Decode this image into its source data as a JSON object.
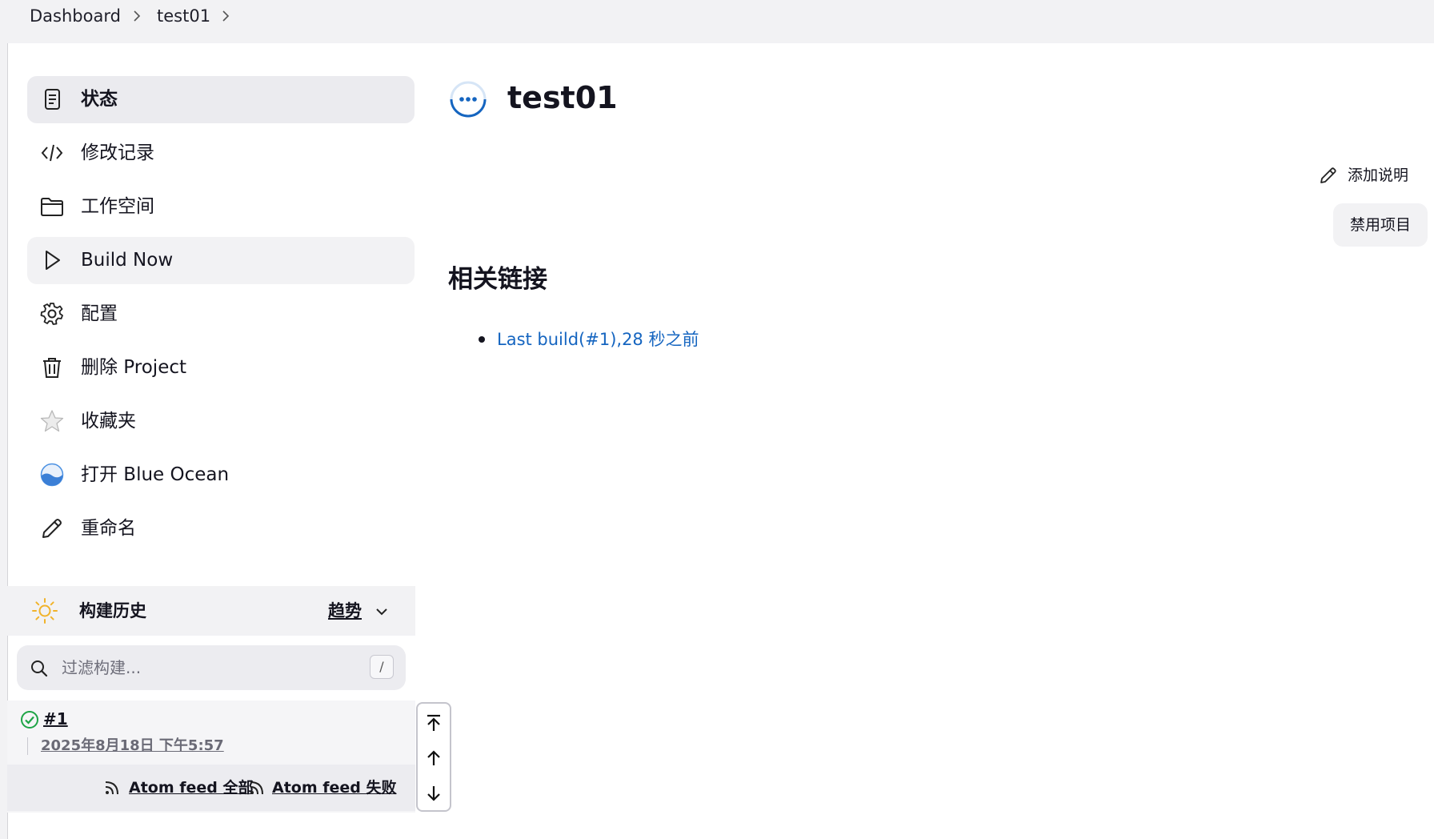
{
  "breadcrumb": [
    "Dashboard",
    "test01"
  ],
  "sidebar": {
    "items": [
      {
        "label": "状态",
        "icon": "document-icon",
        "state": "active"
      },
      {
        "label": "修改记录",
        "icon": "code-icon"
      },
      {
        "label": "工作空间",
        "icon": "folder-icon"
      },
      {
        "label": "Build Now",
        "icon": "play-icon",
        "state": "hover"
      },
      {
        "label": "配置",
        "icon": "gear-icon"
      },
      {
        "label": "删除 Project",
        "icon": "trash-icon"
      },
      {
        "label": "收藏夹",
        "icon": "star-icon"
      },
      {
        "label": "打开 Blue Ocean",
        "icon": "blue-ocean-icon"
      },
      {
        "label": "重命名",
        "icon": "pencil-icon"
      }
    ]
  },
  "build_history": {
    "title": "构建历史",
    "trend": "趋势",
    "filter_placeholder": "过滤构建...",
    "shortcut": "/",
    "builds": [
      {
        "number": "#1",
        "date": "2025年8月18日 下午5:57",
        "status": "success"
      }
    ],
    "feeds": {
      "all_prefix": "Atom feed ",
      "all_suffix": "全部",
      "fail_prefix": "Atom feed ",
      "fail_suffix": "失败"
    }
  },
  "main": {
    "title": "test01",
    "add_description": "添加说明",
    "disable_project": "禁用项目",
    "related_title": "相关链接",
    "related_links": [
      "Last build(#1),28 秒之前"
    ]
  },
  "colors": {
    "accent": "#1565c0",
    "success": "#1ea446",
    "sun": "#f1b32a",
    "sidebar_active": "#ebebef"
  }
}
